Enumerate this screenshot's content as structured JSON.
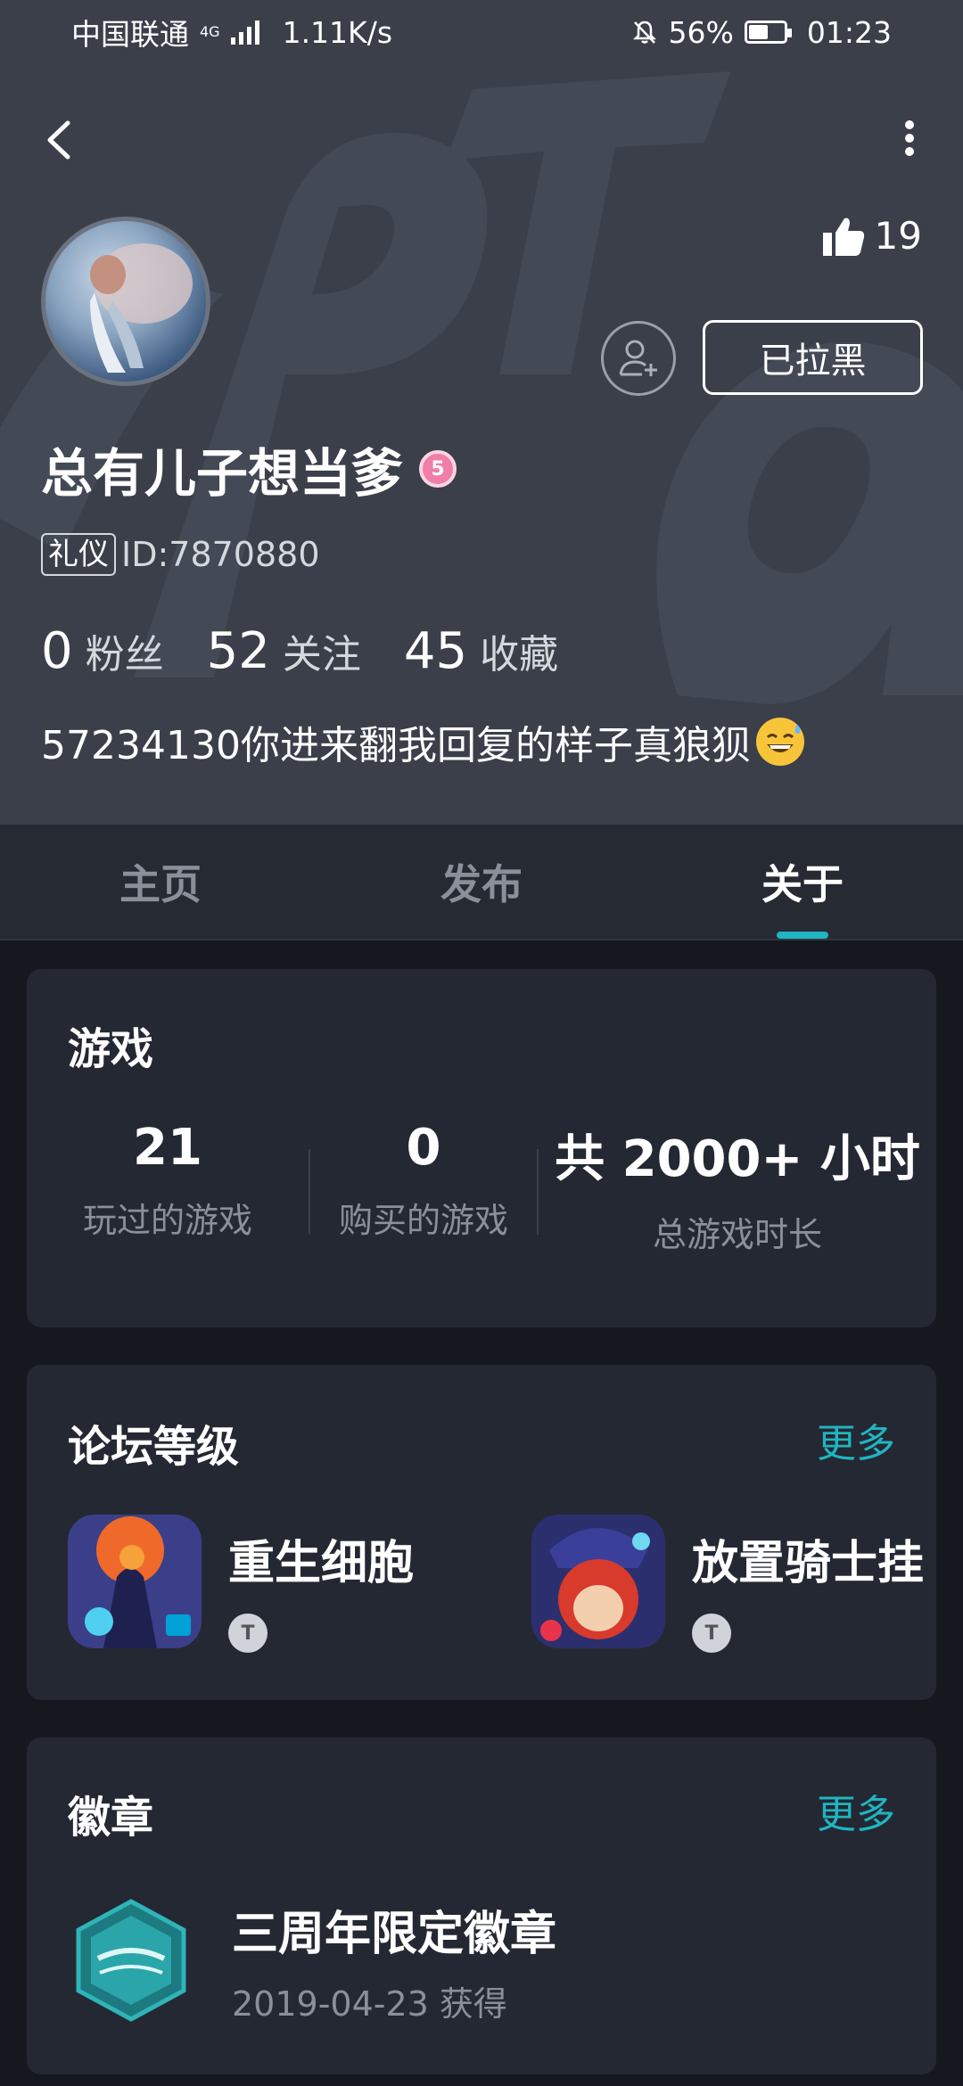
{
  "status_bar": {
    "carrier": "中国联通",
    "network": "4G",
    "speed": "1.11K/s",
    "battery_text": "56%",
    "battery_level": 0.56,
    "time": "01:23"
  },
  "header": {
    "likes": "19",
    "blocked_label": "已拉黑"
  },
  "profile": {
    "username": "总有儿子想当爹",
    "level_mark": "5",
    "tag": "礼仪",
    "id_text": "ID:7870880",
    "stats": [
      {
        "num": "0",
        "label": "粉丝"
      },
      {
        "num": "52",
        "label": "关注"
      },
      {
        "num": "45",
        "label": "收藏"
      }
    ],
    "bio": "57234130你进来翻我回复的样子真狼狈"
  },
  "tabs": [
    {
      "label": "主页"
    },
    {
      "label": "发布"
    },
    {
      "label": "关于"
    }
  ],
  "games_card": {
    "title": "游戏",
    "stats": [
      {
        "num": "21",
        "label": "玩过的游戏"
      },
      {
        "num": "0",
        "label": "购买的游戏"
      },
      {
        "num": "共 2000+ 小时",
        "label": "总游戏时长"
      }
    ]
  },
  "forum_card": {
    "title": "论坛等级",
    "more": "更多",
    "items": [
      {
        "name": "重生细胞",
        "badge": "T"
      },
      {
        "name": "放置骑士挂",
        "badge": "T"
      }
    ]
  },
  "badge_card": {
    "title": "徽章",
    "more": "更多",
    "badge_name": "三周年限定徽章",
    "badge_date": "2019-04-23 获得"
  },
  "colors": {
    "accent": "#1fb5c1",
    "header_bg": "#3a3f4a",
    "card_bg": "#242833",
    "page_bg": "#15181f"
  }
}
